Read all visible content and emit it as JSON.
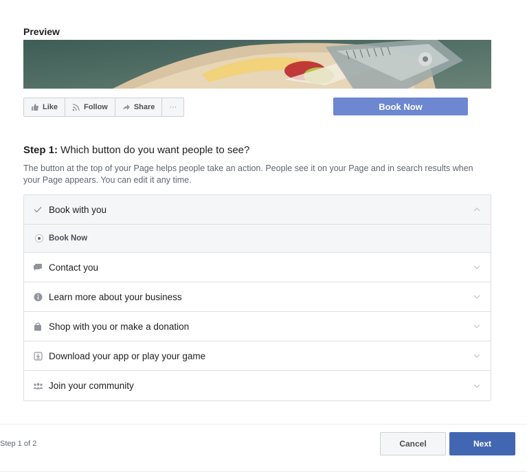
{
  "preview": {
    "title": "Preview",
    "actions": [
      {
        "label": "Like",
        "icon": "thumbs-up-icon"
      },
      {
        "label": "Follow",
        "icon": "rss-icon"
      },
      {
        "label": "Share",
        "icon": "share-arrow-icon"
      },
      {
        "label": "···",
        "icon": "more-icon"
      }
    ],
    "cta_label": "Book Now",
    "cta_color": "#6d87d0"
  },
  "step": {
    "prefix": "Step 1:",
    "question": " Which button do you want people to see?",
    "description": "The button at the top of your Page helps people take an action. People see it on your Page and in search results when your Page appears. You can edit it any time."
  },
  "options": {
    "expanded": {
      "label": "Book with you",
      "icon": "checkmark-icon",
      "state": "expanded"
    },
    "sub_option": {
      "label": "Book Now",
      "selected": true
    },
    "rows": [
      {
        "label": "Contact you",
        "icon": "chat-bubble-icon"
      },
      {
        "label": "Learn more about your business",
        "icon": "info-icon"
      },
      {
        "label": "Shop with you or make a donation",
        "icon": "shopping-bag-icon"
      },
      {
        "label": "Download your app or play your game",
        "icon": "download-icon"
      },
      {
        "label": "Join your community",
        "icon": "people-icon"
      }
    ]
  },
  "footer": {
    "step_count": "Step 1 of 2",
    "cancel_label": "Cancel",
    "next_label": "Next",
    "next_color": "#4267b2"
  }
}
